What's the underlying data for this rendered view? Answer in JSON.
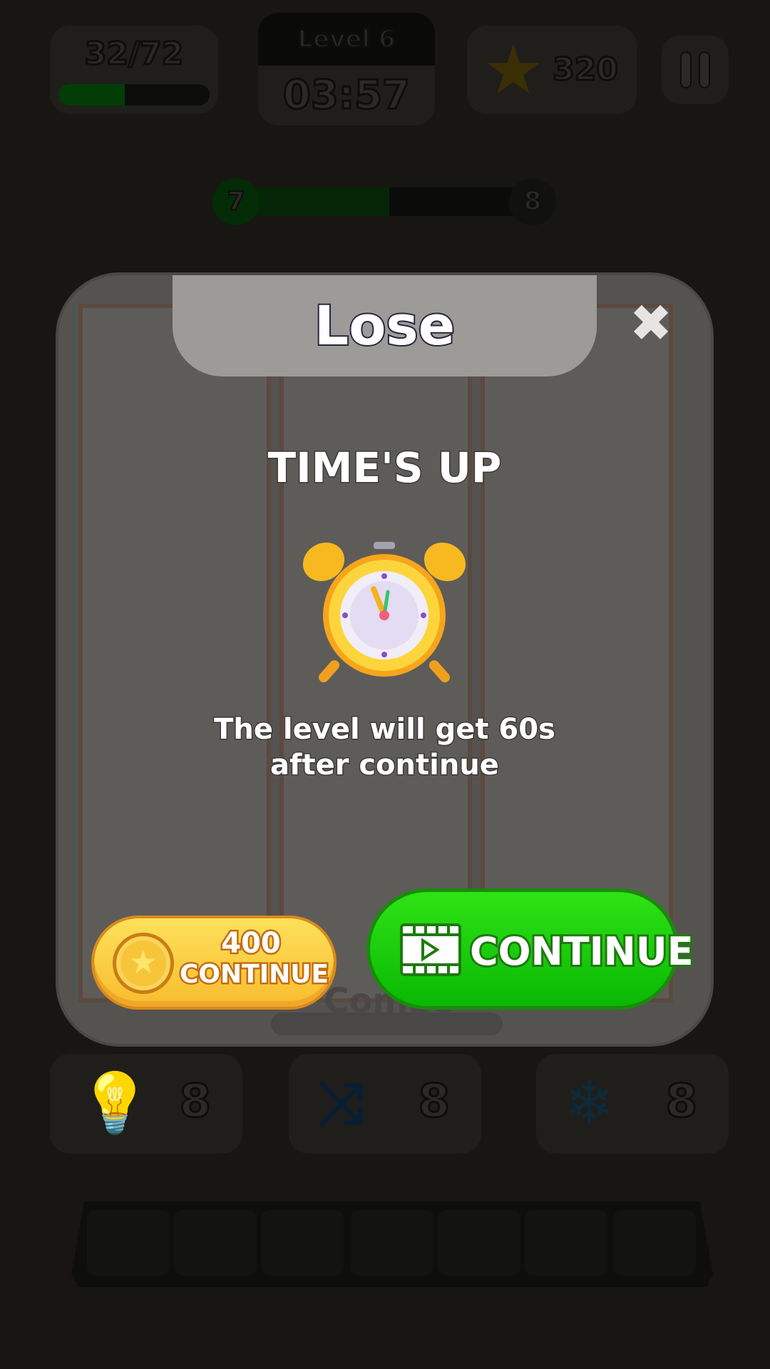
{
  "hud": {
    "progress_text": "32/72",
    "progress_fraction": 0.44,
    "level_title": "Level 6",
    "timer": "03:57",
    "stars": "320",
    "star_icon": "star-icon",
    "pause_icon": "pause-icon"
  },
  "level_progress": {
    "current": "7",
    "next": "8",
    "fraction": 0.52
  },
  "modal": {
    "title": "Lose",
    "close_icon": "close-icon",
    "heading": "TIME'S UP",
    "clock_icon": "alarm-clock-icon",
    "message_line1": "The level will get 60s",
    "message_line2": "after continue",
    "coin_button": {
      "amount": "400",
      "label": "CONTINUE",
      "icon": "coin-icon"
    },
    "ad_button": {
      "label": "CONTINUE",
      "icon": "video-film-icon"
    },
    "background_text": "Combo"
  },
  "boosters": [
    {
      "icon": "lightbulb-icon",
      "count": "8"
    },
    {
      "icon": "shuffle-icon",
      "count": "8"
    },
    {
      "icon": "snowflake-icon",
      "count": "8"
    }
  ],
  "colors": {
    "green": "#0ec20a",
    "gold": "#f8c43a",
    "background": "#171613"
  }
}
